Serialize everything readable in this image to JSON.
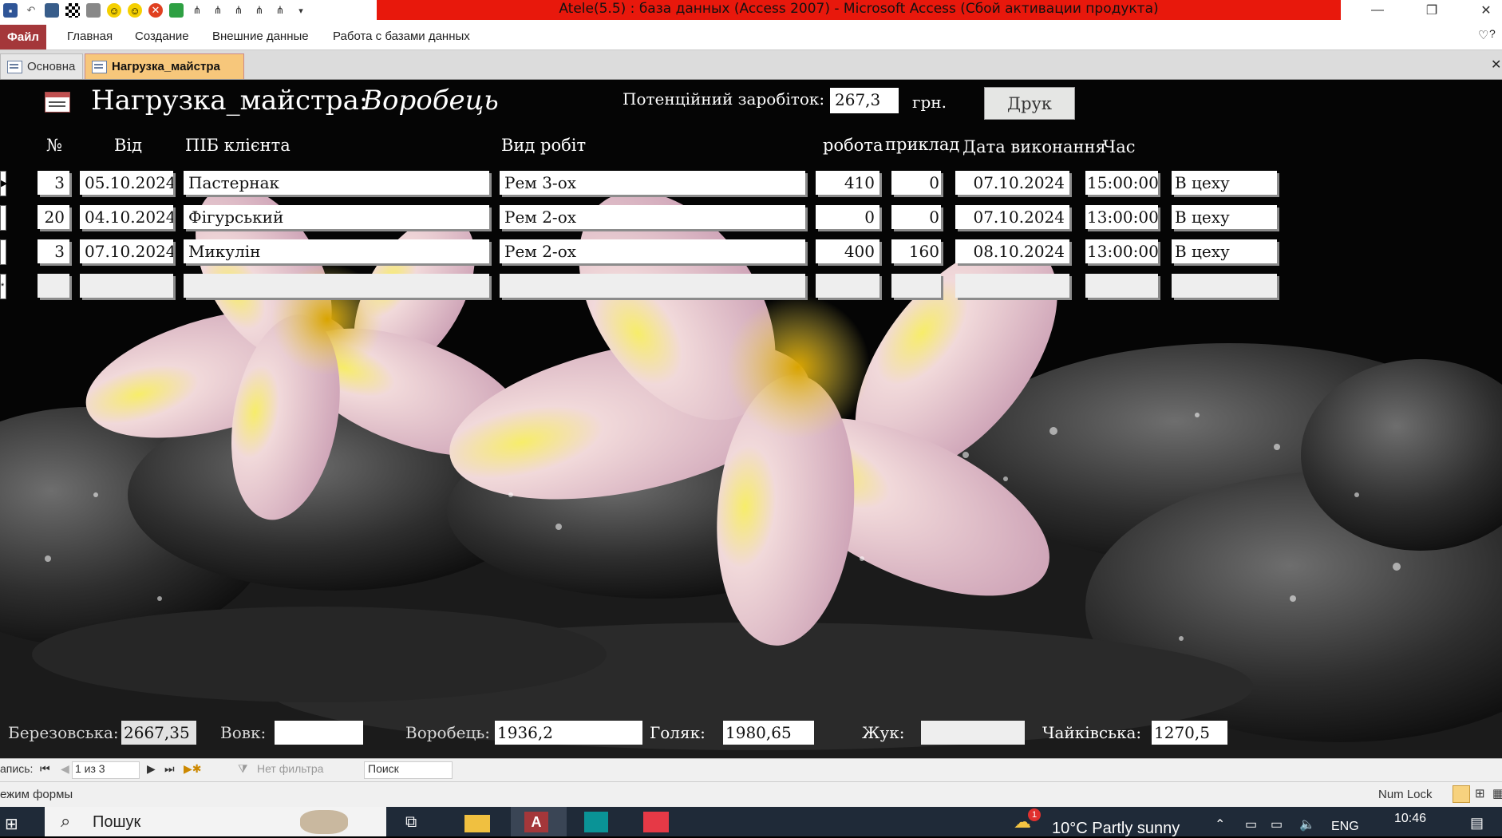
{
  "window": {
    "title": "Atele(5.5) : база данных (Access 2007) - Microsoft Access (Сбой активации продукта)"
  },
  "ribbon": {
    "file": "Файл",
    "tabs": [
      "Главная",
      "Создание",
      "Внешние данные",
      "Работа с базами данных"
    ]
  },
  "doc_tabs": {
    "inactive": "Основна",
    "active": "Нагрузка_майстра"
  },
  "form": {
    "title": "Нагрузка_майстра:",
    "master": "Воробець",
    "earnings_label": "Потенційний заробіток:",
    "earnings_value": "267,3",
    "currency": "грн.",
    "print_button": "Друк",
    "headers": {
      "num": "№",
      "from": "Від",
      "client": "ПІБ клієнта",
      "work_type": "Вид робіт",
      "work": "робота",
      "prykl": "приклад",
      "due_date": "Дата виконання",
      "time": "Час"
    },
    "rows": [
      {
        "num": "3",
        "from": "05.10.2024",
        "client": "Пастернак",
        "work_type": "Рем 3-ох",
        "work": "410",
        "prykl": "0",
        "due_date": "07.10.2024",
        "time": "15:00:00",
        "status": "В цеху"
      },
      {
        "num": "20",
        "from": "04.10.2024",
        "client": "Фігурський",
        "work_type": "Рем 2-ох",
        "work": "0",
        "prykl": "0",
        "due_date": "07.10.2024",
        "time": "13:00:00",
        "status": "В цеху"
      },
      {
        "num": "3",
        "from": "07.10.2024",
        "client": "Микулін",
        "work_type": "Рем 2-ох",
        "work": "400",
        "prykl": "160",
        "due_date": "08.10.2024",
        "time": "13:00:00",
        "status": "В цеху"
      }
    ],
    "new_row_marker": "*",
    "totals": {
      "berez_label": "Березовська:",
      "berez_value": "2667,35",
      "vovk_label": "Вовк:",
      "vovk_value": "",
      "vorob_label": "Воробець:",
      "vorob_value": "1936,2",
      "golyak_label": "Голяк:",
      "golyak_value": "1980,65",
      "zhuk_label": "Жук:",
      "zhuk_value": "",
      "chaik_label": "Чайківська:",
      "chaik_value": "1270,5"
    }
  },
  "navigation": {
    "record_label": "апись:",
    "record_value": "1 из 3",
    "filter": "Нет фильтра",
    "search": "Поиск"
  },
  "status": {
    "mode": "ежим формы",
    "numlock": "Num Lock"
  },
  "taskbar": {
    "search_placeholder": "Пошук",
    "weather": "10°C  Partly sunny",
    "lang": "ENG",
    "time": "10:46",
    "notif_badge": "1"
  },
  "colors": {
    "title_red": "#e8180c",
    "file_tab": "#a4373a",
    "active_tab": "#f7c77b"
  }
}
